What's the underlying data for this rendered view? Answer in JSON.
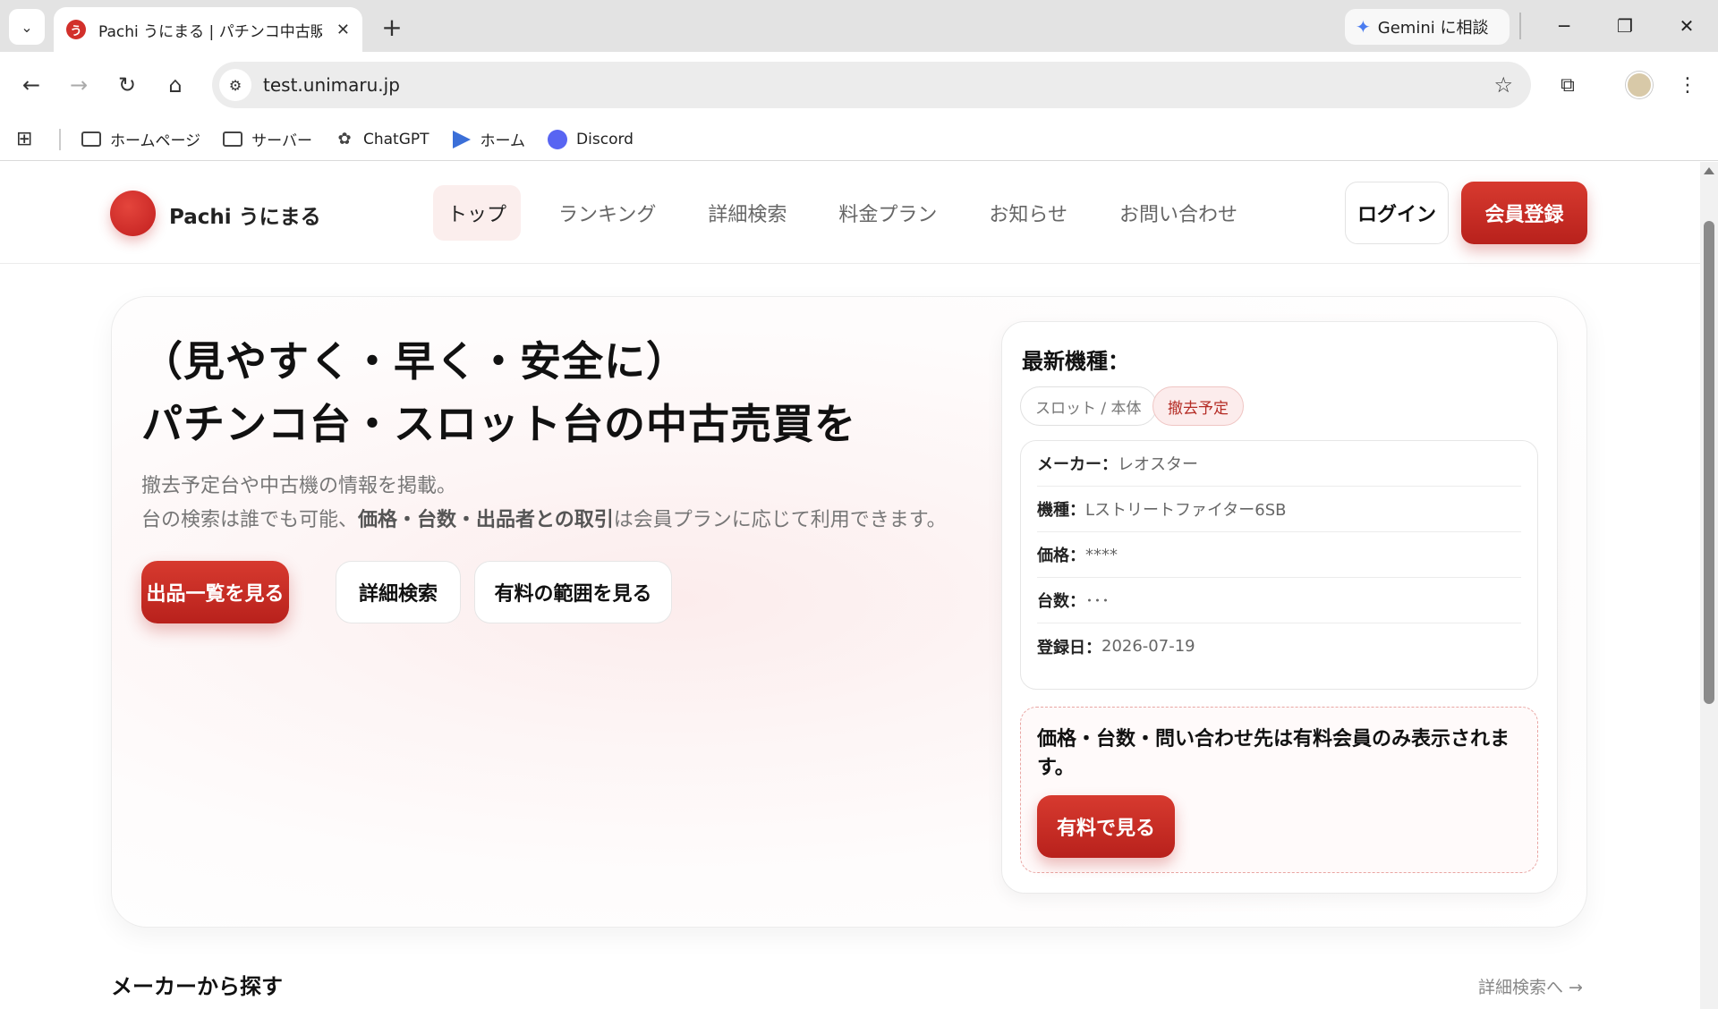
{
  "browser": {
    "tab_title": "Pachi うにまる | パチンコ中古販売・",
    "tab_favicon": "う",
    "gemini_label": "Gemini に相談",
    "url": "test.unimaru.jp",
    "bookmarks": [
      {
        "label": "ホームページ",
        "icon": "folder-icon"
      },
      {
        "label": "サーバー",
        "icon": "folder-icon"
      },
      {
        "label": "ChatGPT",
        "icon": "chatgpt-icon"
      },
      {
        "label": "ホーム",
        "icon": "home-triangle-icon"
      },
      {
        "label": "Discord",
        "icon": "discord-icon"
      }
    ]
  },
  "site": {
    "logo_text": "Pachi うにまる",
    "nav": [
      "トップ",
      "ランキング",
      "詳細検索",
      "料金プラン",
      "お知らせ",
      "お問い合わせ"
    ],
    "active_nav": "トップ",
    "login": "ログイン",
    "register": "会員登録"
  },
  "hero": {
    "title_line1": "（見やすく・早く・安全に）",
    "title_line2": "パチンコ台・スロット台の中古売買を",
    "desc_line1": "撤去予定台や中古機の情報を掲載。",
    "desc_line2_pre": "台の検索は誰でも可能、",
    "desc_line2_bold": "価格・台数・出品者との取引",
    "desc_line2_post": "は会員プランに応じて利用できます。",
    "btn_list": "出品一覧を見る",
    "btn_search": "詳細検索",
    "btn_paid": "有料の範囲を見る"
  },
  "card": {
    "title": "最新機種：",
    "chip_type": "スロット / 本体",
    "chip_status": "撤去予定",
    "specs": [
      {
        "key": "メーカー：",
        "value": "レオスター"
      },
      {
        "key": "機種：",
        "value": "Lストリートファイター6SB"
      },
      {
        "key": "価格：",
        "value": "****"
      },
      {
        "key": "台数：",
        "value": "･･･"
      },
      {
        "key": "登録日：",
        "value": "2026-07-19"
      }
    ],
    "notice_text": "価格・台数・問い合わせ先は有料会員のみ表示されます。",
    "notice_btn": "有料で見る"
  },
  "section": {
    "title": "メーカーから探す",
    "link": "詳細検索へ →"
  },
  "colors": {
    "brand": "#c9281f",
    "chip_red_bg": "#fcecec"
  }
}
